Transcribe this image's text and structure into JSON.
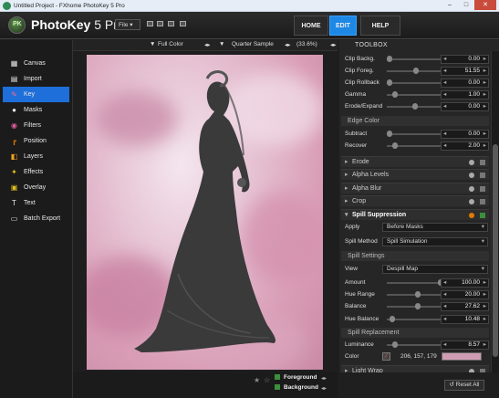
{
  "window": {
    "title": "Untitled Project - FXhome PhotoKey 5 Pro",
    "min": "–",
    "max": "□",
    "close": "✕"
  },
  "header": {
    "brand": "PhotoKey",
    "version": "5 Pro",
    "file_menu": "File",
    "nav": [
      {
        "label": "HOME"
      },
      {
        "label": "EDIT"
      },
      {
        "label": "HELP"
      }
    ],
    "active_nav": "EDIT"
  },
  "sidebar": {
    "items": [
      {
        "label": "Canvas",
        "icon": "canvas-icon"
      },
      {
        "label": "Import",
        "icon": "import-icon"
      },
      {
        "label": "Key",
        "icon": "key-icon"
      },
      {
        "label": "Masks",
        "icon": "masks-icon"
      },
      {
        "label": "Filters",
        "icon": "filters-icon"
      },
      {
        "label": "Position",
        "icon": "position-icon"
      },
      {
        "label": "Layers",
        "icon": "layers-icon"
      },
      {
        "label": "Effects",
        "icon": "effects-icon"
      },
      {
        "label": "Overlay",
        "icon": "overlay-icon"
      },
      {
        "label": "Text",
        "icon": "text-icon"
      },
      {
        "label": "Batch Export",
        "icon": "batch-export-icon"
      }
    ],
    "active": "Key"
  },
  "viewbar": {
    "color_mode": "Full Color",
    "quality": "Quarter Sample",
    "zoom": "(33.6%)"
  },
  "canvas_footer": {
    "foreground": "Foreground",
    "background": "Background"
  },
  "toolbox": {
    "title": "TOOLBOX",
    "key_rows": [
      {
        "label": "Clip Backg.",
        "value": "0.00",
        "pos": 0.0
      },
      {
        "label": "Clip Foreg.",
        "value": "51.55",
        "pos": 0.52
      },
      {
        "label": "Clip Rollback",
        "value": "0.00",
        "pos": 0.0
      },
      {
        "label": "Gamma",
        "value": "1.00",
        "pos": 0.1
      },
      {
        "label": "Erode/Expand",
        "value": "0.00",
        "pos": 0.5
      }
    ],
    "edge_color": {
      "title": "Edge Color",
      "rows": [
        {
          "label": "Subtract",
          "value": "0.00",
          "pos": 0.0
        },
        {
          "label": "Recover",
          "value": "2.00",
          "pos": 0.1
        }
      ]
    },
    "panels": [
      "Erode",
      "Alpha Levels",
      "Alpha Blur",
      "Crop"
    ],
    "spill": {
      "title": "Spill Suppression",
      "apply_label": "Apply",
      "apply_value": "Before Masks",
      "method_label": "Spill Method",
      "method_value": "Spill Simulation",
      "settings_title": "Spill Settings",
      "view_label": "View",
      "view_value": "Despill Map",
      "rows": [
        {
          "label": "Amount",
          "value": "100.00",
          "pos": 1.0
        },
        {
          "label": "Hue Range",
          "value": "20.00",
          "pos": 0.55
        },
        {
          "label": "Balance",
          "value": "27.62",
          "pos": 0.55
        },
        {
          "label": "Hue Balance",
          "value": "10.48",
          "pos": 0.05
        }
      ],
      "replacement_title": "Spill Replacement",
      "luminance_label": "Luminance",
      "luminance_value": "8.57",
      "luminance_pos": 0.1,
      "color_label": "Color",
      "color_value": "206, 157, 179",
      "color_hex": "#ce9db3"
    },
    "last_panel": "Light Wrap",
    "reset_all": "Reset All"
  },
  "colors": {
    "accent": "#1e88e5",
    "active_sidebar": "#1e6fd9",
    "spill_color": "#ce9db3"
  }
}
